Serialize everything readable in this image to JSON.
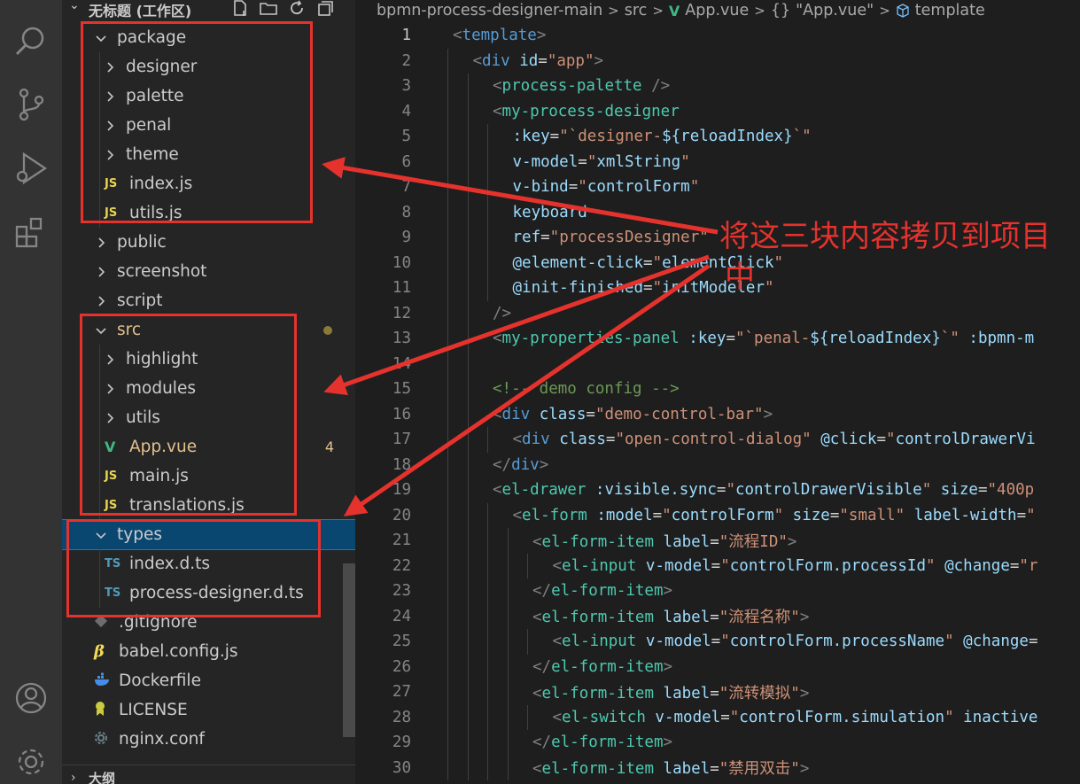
{
  "explorer": {
    "workspace_title": "无标题 (工作区)",
    "items": [
      {
        "label": "package",
        "kind": "folder-open",
        "depth": 1
      },
      {
        "label": "designer",
        "kind": "folder",
        "depth": 2
      },
      {
        "label": "palette",
        "kind": "folder",
        "depth": 2
      },
      {
        "label": "penal",
        "kind": "folder",
        "depth": 2
      },
      {
        "label": "theme",
        "kind": "folder",
        "depth": 2
      },
      {
        "label": "index.js",
        "kind": "js",
        "depth": 2
      },
      {
        "label": "utils.js",
        "kind": "js",
        "depth": 2
      },
      {
        "label": "public",
        "kind": "folder",
        "depth": 1
      },
      {
        "label": "screenshot",
        "kind": "folder",
        "depth": 1
      },
      {
        "label": "script",
        "kind": "folder",
        "depth": 1
      },
      {
        "label": "src",
        "kind": "folder-open",
        "depth": 1,
        "modified": true
      },
      {
        "label": "highlight",
        "kind": "folder",
        "depth": 2
      },
      {
        "label": "modules",
        "kind": "folder",
        "depth": 2
      },
      {
        "label": "utils",
        "kind": "folder",
        "depth": 2
      },
      {
        "label": "App.vue",
        "kind": "vue",
        "depth": 2,
        "badge": "4"
      },
      {
        "label": "main.js",
        "kind": "js",
        "depth": 2
      },
      {
        "label": "translations.js",
        "kind": "js",
        "depth": 2
      },
      {
        "label": "types",
        "kind": "folder-open",
        "depth": 1,
        "selected": true
      },
      {
        "label": "index.d.ts",
        "kind": "ts",
        "depth": 2
      },
      {
        "label": "process-designer.d.ts",
        "kind": "ts",
        "depth": 2
      },
      {
        "label": ".gitignore",
        "kind": "git",
        "depth": 1
      },
      {
        "label": "babel.config.js",
        "kind": "babel",
        "depth": 1
      },
      {
        "label": "Dockerfile",
        "kind": "docker",
        "depth": 1
      },
      {
        "label": "LICENSE",
        "kind": "license",
        "depth": 1
      },
      {
        "label": "nginx.conf",
        "kind": "gear",
        "depth": 1
      }
    ],
    "outline_title": "大纲",
    "icon_labels": {
      "js": "JS",
      "ts": "TS",
      "vue": "V"
    }
  },
  "breadcrumb": {
    "root": "bpmn-process-designer-main",
    "folder": "src",
    "file": "App.vue",
    "symbol_prefix": "{}",
    "symbol": "\"App.vue\"",
    "section": "template",
    "sep": ">"
  },
  "code": {
    "active_line": 1,
    "lines": [
      {
        "n": "1",
        "indent": 0,
        "tokens": [
          [
            "punc",
            "<"
          ],
          [
            "tag",
            "template"
          ],
          [
            "punc",
            ">"
          ]
        ]
      },
      {
        "n": "2",
        "indent": 1,
        "tokens": [
          [
            "punc",
            "<"
          ],
          [
            "tag",
            "div"
          ],
          [
            "plain",
            " "
          ],
          [
            "attr",
            "id"
          ],
          [
            "eq",
            "="
          ],
          [
            "str",
            "\"app\""
          ],
          [
            "punc",
            ">"
          ]
        ]
      },
      {
        "n": "3",
        "indent": 2,
        "tokens": [
          [
            "punc",
            "<"
          ],
          [
            "tagx",
            "process-palette"
          ],
          [
            "plain",
            " "
          ],
          [
            "punc",
            "/>"
          ]
        ]
      },
      {
        "n": "4",
        "indent": 2,
        "tokens": [
          [
            "punc",
            "<"
          ],
          [
            "tagx",
            "my-process-designer"
          ]
        ]
      },
      {
        "n": "5",
        "indent": 3,
        "tokens": [
          [
            "attr",
            ":key"
          ],
          [
            "eq",
            "="
          ],
          [
            "str",
            "\"`designer-"
          ],
          [
            "tmpl",
            "${reloadIndex}"
          ],
          [
            "str",
            "`\""
          ]
        ]
      },
      {
        "n": "6",
        "indent": 3,
        "tokens": [
          [
            "attr",
            "v-model"
          ],
          [
            "eq",
            "="
          ],
          [
            "str",
            "\""
          ],
          [
            "tmpl",
            "xmlString"
          ],
          [
            "str",
            "\""
          ]
        ]
      },
      {
        "n": "7",
        "indent": 3,
        "tokens": [
          [
            "attr",
            "v-bind"
          ],
          [
            "eq",
            "="
          ],
          [
            "str",
            "\""
          ],
          [
            "tmpl",
            "controlForm"
          ],
          [
            "str",
            "\""
          ]
        ]
      },
      {
        "n": "8",
        "indent": 3,
        "tokens": [
          [
            "attr",
            "keyboard"
          ]
        ]
      },
      {
        "n": "9",
        "indent": 3,
        "tokens": [
          [
            "attr",
            "ref"
          ],
          [
            "eq",
            "="
          ],
          [
            "str",
            "\"processDesigner\""
          ]
        ]
      },
      {
        "n": "10",
        "indent": 3,
        "tokens": [
          [
            "attr",
            "@element-click"
          ],
          [
            "eq",
            "="
          ],
          [
            "str",
            "\""
          ],
          [
            "tmpl",
            "elementClick"
          ],
          [
            "str",
            "\""
          ]
        ]
      },
      {
        "n": "11",
        "indent": 3,
        "tokens": [
          [
            "attr",
            "@init-finished"
          ],
          [
            "eq",
            "="
          ],
          [
            "str",
            "\""
          ],
          [
            "tmpl",
            "initModeler"
          ],
          [
            "str",
            "\""
          ]
        ]
      },
      {
        "n": "12",
        "indent": 2,
        "tokens": [
          [
            "punc",
            "/>"
          ]
        ]
      },
      {
        "n": "13",
        "indent": 2,
        "tokens": [
          [
            "punc",
            "<"
          ],
          [
            "tagx",
            "my-properties-panel"
          ],
          [
            "plain",
            " "
          ],
          [
            "attr",
            ":key"
          ],
          [
            "eq",
            "="
          ],
          [
            "str",
            "\"`penal-"
          ],
          [
            "tmpl",
            "${reloadIndex}"
          ],
          [
            "str",
            "`\""
          ],
          [
            "plain",
            " "
          ],
          [
            "attr",
            ":bpmn-m"
          ]
        ]
      },
      {
        "n": "14",
        "indent": 2,
        "tokens": []
      },
      {
        "n": "15",
        "indent": 2,
        "tokens": [
          [
            "cmt",
            "<!-- demo config -->"
          ]
        ]
      },
      {
        "n": "16",
        "indent": 2,
        "tokens": [
          [
            "punc",
            "<"
          ],
          [
            "tag",
            "div"
          ],
          [
            "plain",
            " "
          ],
          [
            "attr",
            "class"
          ],
          [
            "eq",
            "="
          ],
          [
            "str",
            "\"demo-control-bar\""
          ],
          [
            "punc",
            ">"
          ]
        ]
      },
      {
        "n": "17",
        "indent": 3,
        "tokens": [
          [
            "punc",
            "<"
          ],
          [
            "tag",
            "div"
          ],
          [
            "plain",
            " "
          ],
          [
            "attr",
            "class"
          ],
          [
            "eq",
            "="
          ],
          [
            "str",
            "\"open-control-dialog\""
          ],
          [
            "plain",
            " "
          ],
          [
            "attr",
            "@click"
          ],
          [
            "eq",
            "="
          ],
          [
            "str",
            "\""
          ],
          [
            "tmpl",
            "controlDrawerVi"
          ]
        ]
      },
      {
        "n": "18",
        "indent": 2,
        "tokens": [
          [
            "punc",
            "</"
          ],
          [
            "tag",
            "div"
          ],
          [
            "punc",
            ">"
          ]
        ]
      },
      {
        "n": "19",
        "indent": 2,
        "tokens": [
          [
            "punc",
            "<"
          ],
          [
            "tagx",
            "el-drawer"
          ],
          [
            "plain",
            " "
          ],
          [
            "attr",
            ":visible.sync"
          ],
          [
            "eq",
            "="
          ],
          [
            "str",
            "\""
          ],
          [
            "tmpl",
            "controlDrawerVisible"
          ],
          [
            "str",
            "\""
          ],
          [
            "plain",
            " "
          ],
          [
            "attr",
            "size"
          ],
          [
            "eq",
            "="
          ],
          [
            "str",
            "\"400p"
          ]
        ]
      },
      {
        "n": "20",
        "indent": 3,
        "tokens": [
          [
            "punc",
            "<"
          ],
          [
            "tagx",
            "el-form"
          ],
          [
            "plain",
            " "
          ],
          [
            "attr",
            ":model"
          ],
          [
            "eq",
            "="
          ],
          [
            "str",
            "\""
          ],
          [
            "tmpl",
            "controlForm"
          ],
          [
            "str",
            "\""
          ],
          [
            "plain",
            " "
          ],
          [
            "attr",
            "size"
          ],
          [
            "eq",
            "="
          ],
          [
            "str",
            "\"small\""
          ],
          [
            "plain",
            " "
          ],
          [
            "attr",
            "label-width"
          ],
          [
            "eq",
            "="
          ],
          [
            "str",
            "\""
          ]
        ]
      },
      {
        "n": "21",
        "indent": 4,
        "tokens": [
          [
            "punc",
            "<"
          ],
          [
            "tagx",
            "el-form-item"
          ],
          [
            "plain",
            " "
          ],
          [
            "attr",
            "label"
          ],
          [
            "eq",
            "="
          ],
          [
            "str",
            "\"流程ID\""
          ],
          [
            "punc",
            ">"
          ]
        ]
      },
      {
        "n": "22",
        "indent": 5,
        "tokens": [
          [
            "punc",
            "<"
          ],
          [
            "tagx",
            "el-input"
          ],
          [
            "plain",
            " "
          ],
          [
            "attr",
            "v-model"
          ],
          [
            "eq",
            "="
          ],
          [
            "str",
            "\""
          ],
          [
            "tmpl",
            "controlForm.processId"
          ],
          [
            "str",
            "\""
          ],
          [
            "plain",
            " "
          ],
          [
            "attr",
            "@change"
          ],
          [
            "eq",
            "="
          ],
          [
            "str",
            "\"r"
          ]
        ]
      },
      {
        "n": "23",
        "indent": 4,
        "tokens": [
          [
            "punc",
            "</"
          ],
          [
            "tagx",
            "el-form-item"
          ],
          [
            "punc",
            ">"
          ]
        ]
      },
      {
        "n": "24",
        "indent": 4,
        "tokens": [
          [
            "punc",
            "<"
          ],
          [
            "tagx",
            "el-form-item"
          ],
          [
            "plain",
            " "
          ],
          [
            "attr",
            "label"
          ],
          [
            "eq",
            "="
          ],
          [
            "str",
            "\"流程名称\""
          ],
          [
            "punc",
            ">"
          ]
        ]
      },
      {
        "n": "25",
        "indent": 5,
        "tokens": [
          [
            "punc",
            "<"
          ],
          [
            "tagx",
            "el-input"
          ],
          [
            "plain",
            " "
          ],
          [
            "attr",
            "v-model"
          ],
          [
            "eq",
            "="
          ],
          [
            "str",
            "\""
          ],
          [
            "tmpl",
            "controlForm.processName"
          ],
          [
            "str",
            "\""
          ],
          [
            "plain",
            " "
          ],
          [
            "attr",
            "@change"
          ],
          [
            "eq",
            "="
          ]
        ]
      },
      {
        "n": "26",
        "indent": 4,
        "tokens": [
          [
            "punc",
            "</"
          ],
          [
            "tagx",
            "el-form-item"
          ],
          [
            "punc",
            ">"
          ]
        ]
      },
      {
        "n": "27",
        "indent": 4,
        "tokens": [
          [
            "punc",
            "<"
          ],
          [
            "tagx",
            "el-form-item"
          ],
          [
            "plain",
            " "
          ],
          [
            "attr",
            "label"
          ],
          [
            "eq",
            "="
          ],
          [
            "str",
            "\"流转模拟\""
          ],
          [
            "punc",
            ">"
          ]
        ]
      },
      {
        "n": "28",
        "indent": 5,
        "tokens": [
          [
            "punc",
            "<"
          ],
          [
            "tagx",
            "el-switch"
          ],
          [
            "plain",
            " "
          ],
          [
            "attr",
            "v-model"
          ],
          [
            "eq",
            "="
          ],
          [
            "str",
            "\""
          ],
          [
            "tmpl",
            "controlForm.simulation"
          ],
          [
            "str",
            "\""
          ],
          [
            "plain",
            " "
          ],
          [
            "attr",
            "inactive"
          ]
        ]
      },
      {
        "n": "29",
        "indent": 4,
        "tokens": [
          [
            "punc",
            "</"
          ],
          [
            "tagx",
            "el-form-item"
          ],
          [
            "punc",
            ">"
          ]
        ]
      },
      {
        "n": "30",
        "indent": 4,
        "tokens": [
          [
            "punc",
            "<"
          ],
          [
            "tagx",
            "el-form-item"
          ],
          [
            "plain",
            " "
          ],
          [
            "attr",
            "label"
          ],
          [
            "eq",
            "="
          ],
          [
            "str",
            "\"禁用双击\""
          ],
          [
            "punc",
            ">"
          ]
        ]
      }
    ]
  },
  "annotation": {
    "line1": "将这三块内容拷贝到项目",
    "line2": "中",
    "color": "#e5322d"
  },
  "colors": {
    "activity_bar": "#333333",
    "sidebar": "#252526",
    "editor": "#1e1e1e",
    "selection": "#094771"
  }
}
